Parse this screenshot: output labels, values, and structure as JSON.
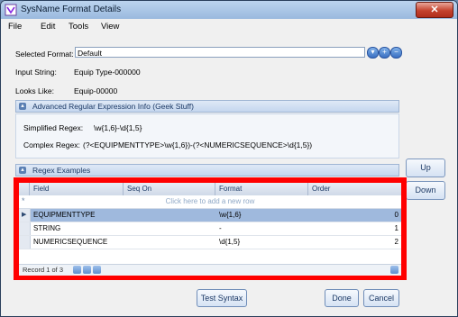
{
  "window": {
    "title": "SysName Format Details",
    "close_glyph": "✕"
  },
  "menu": [
    "File",
    "Edit",
    "Tools",
    "View"
  ],
  "form": {
    "selected_format_label": "Selected Format:",
    "selected_format_value": "Default",
    "input_string_label": "Input String:",
    "input_string_value": "Equip Type-000000",
    "looks_like_label": "Looks Like:",
    "looks_like_value": "Equip-00000"
  },
  "advanced": {
    "header": "Advanced Regular Expression Info (Geek Stuff)",
    "simplified_label": "Simplified Regex:",
    "simplified_value": "\\w{1,6}-\\d{1,5}",
    "complex_label": "Complex Regex:",
    "complex_value": "(?<EQUIPMENTTYPE>\\w{1,6})-(?<NUMERICSEQUENCE>\\d{1,5})"
  },
  "regex_examples": {
    "header": "Regex Examples"
  },
  "side_buttons": {
    "up": "Up",
    "down": "Down"
  },
  "grid": {
    "columns": [
      "Field",
      "Seq On",
      "Format",
      "Order"
    ],
    "new_row_text": "Click here to add a new row",
    "new_row_marker": "*",
    "rows": [
      {
        "field": "EQUIPMENTTYPE",
        "seq_on": "",
        "format": "\\w{1,6}",
        "order": "0",
        "selected": true
      },
      {
        "field": "STRING",
        "seq_on": "",
        "format": "-",
        "order": "1",
        "selected": false
      },
      {
        "field": "NUMERICSEQUENCE",
        "seq_on": "",
        "format": "\\d{1,5}",
        "order": "2",
        "selected": false
      }
    ],
    "pager_text": "Record 1 of 3"
  },
  "buttons": {
    "test_syntax": "Test Syntax",
    "done": "Done",
    "cancel": "Cancel"
  },
  "colors": {
    "highlight_border": "#ff0000",
    "selected_row": "#9fb9dd",
    "title_bar": "#bcd4ee"
  }
}
